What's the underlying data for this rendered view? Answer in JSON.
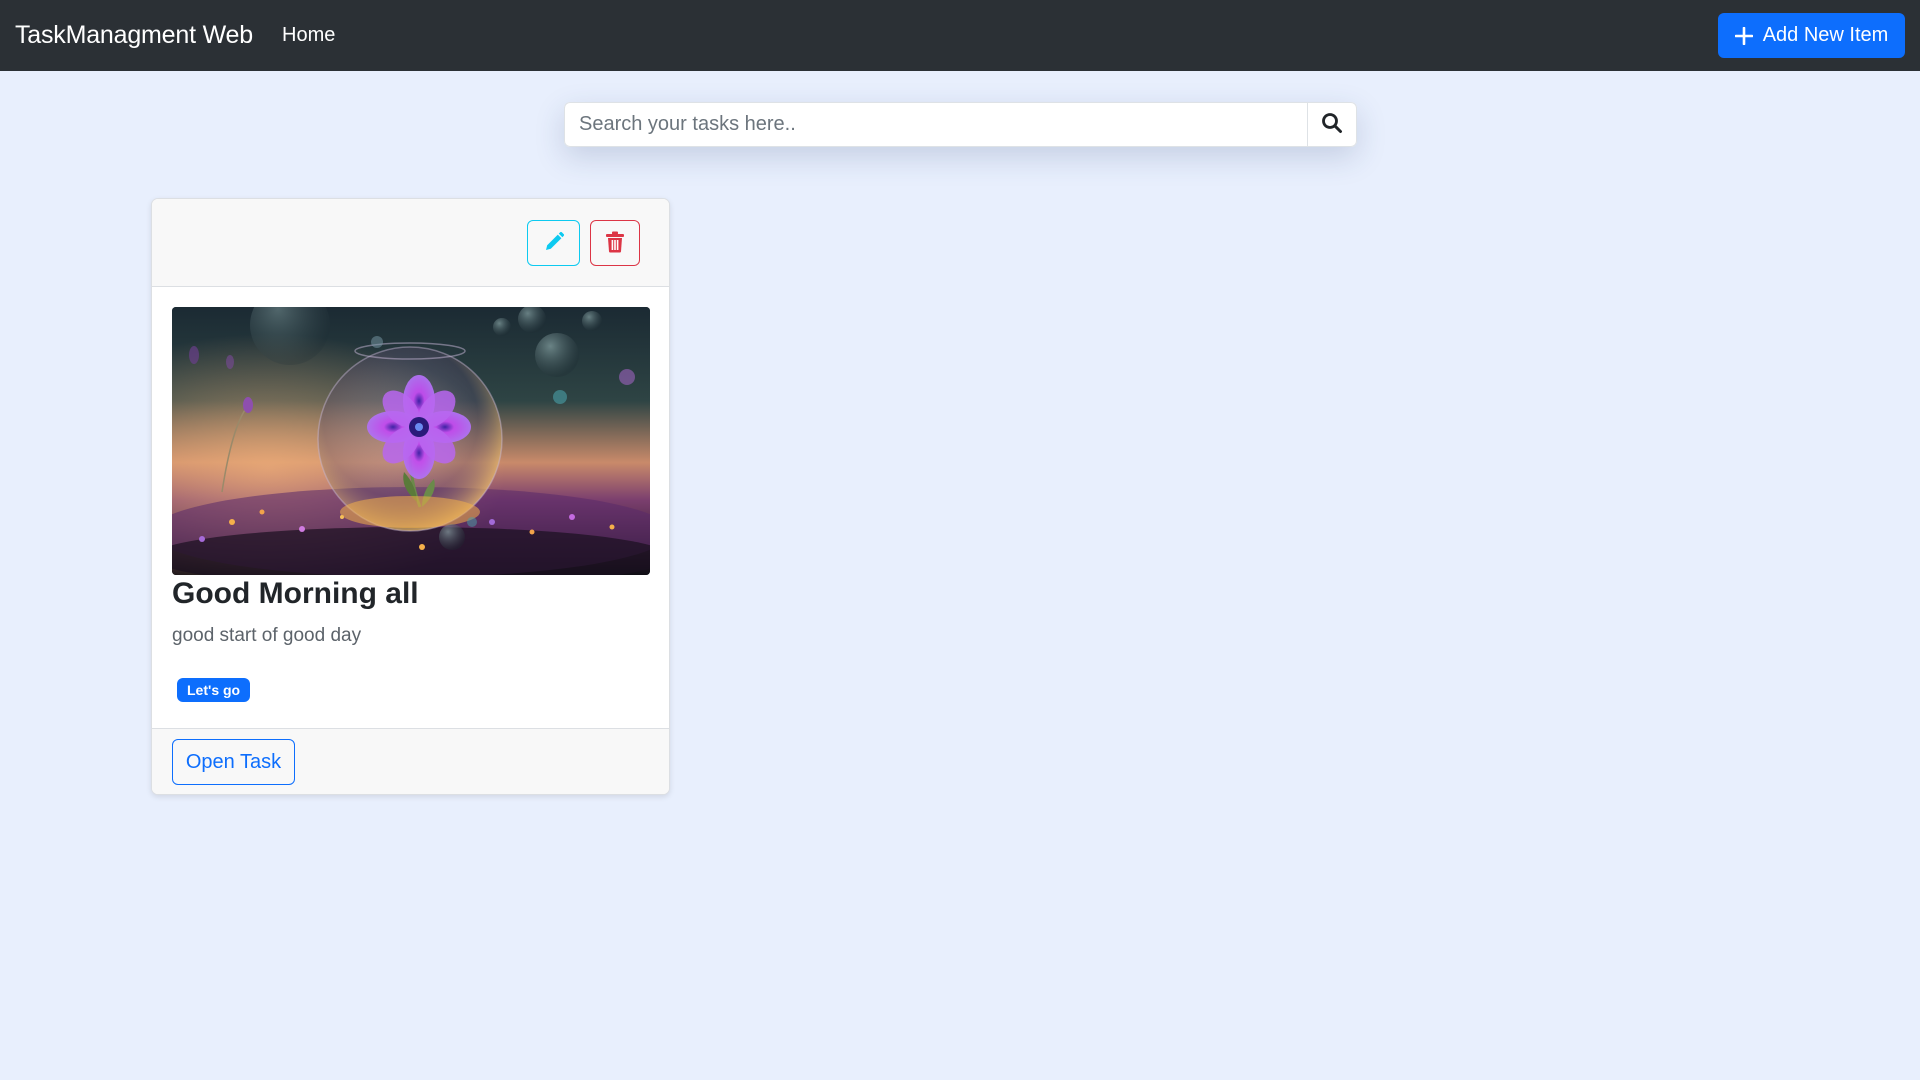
{
  "navbar": {
    "brand": "TaskManagment Web",
    "home_label": "Home",
    "add_button_label": "Add New Item",
    "add_icon": "plus-icon",
    "background_color": "#2b3035"
  },
  "search": {
    "placeholder": "Search your tasks here..",
    "value": "",
    "icon": "search-icon"
  },
  "tasks": [
    {
      "title": "Good Morning all",
      "description": "good start of good day",
      "badge": "Let's go",
      "open_label": "Open Task",
      "edit_icon": "pencil-icon",
      "delete_icon": "trash-icon",
      "image": "flower-in-glass-bubble"
    }
  ],
  "colors": {
    "primary": "#0d6efd",
    "info": "#0dcaf0",
    "danger": "#dc3545",
    "page_background": "#e8effd"
  }
}
